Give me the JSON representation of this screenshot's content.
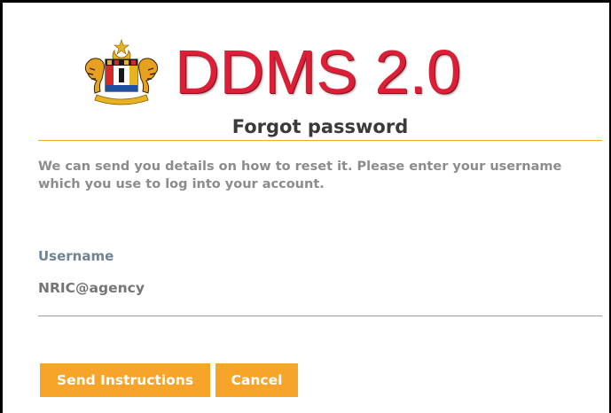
{
  "brand": {
    "title": "DDMS 2.0",
    "logo_icon": "malaysia-coat-of-arms-icon",
    "color": "#dc1f36"
  },
  "form": {
    "title": "Forgot password",
    "intro": "We can send you details on how to reset it. Please enter your username which you use to log into your account.",
    "username": {
      "label": "Username",
      "placeholder": "NRIC@agency",
      "value": ""
    }
  },
  "actions": {
    "send_label": "Send Instructions",
    "cancel_label": "Cancel",
    "button_color": "#f7a42a"
  },
  "colors": {
    "accent_rule": "#f5a623",
    "label": "#6f8494",
    "muted_text": "#8c8c8c"
  }
}
